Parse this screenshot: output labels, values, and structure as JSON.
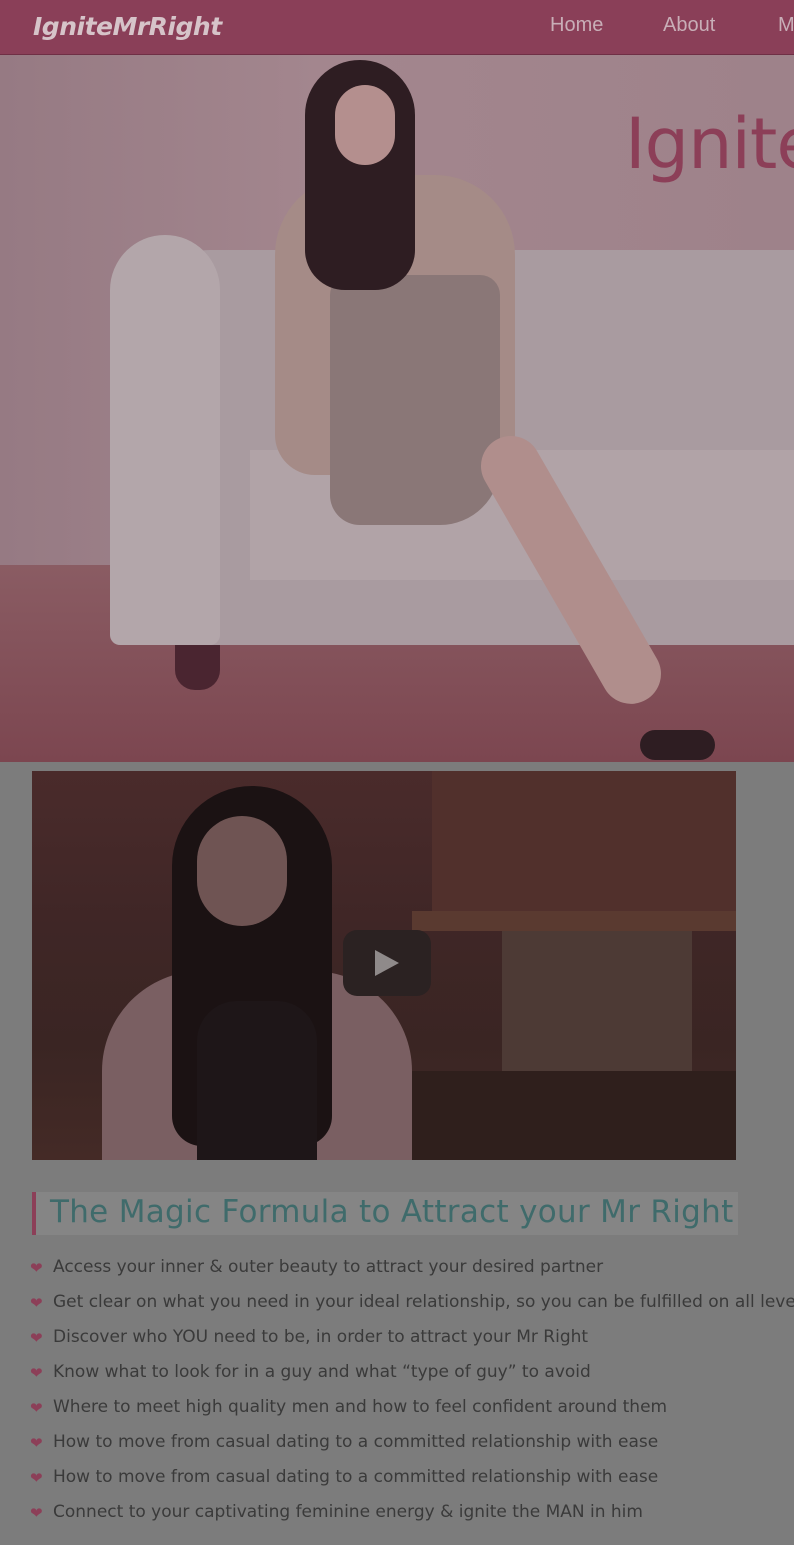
{
  "header": {
    "logo": "IgniteMrRight",
    "nav": [
      "Home",
      "About",
      "M"
    ]
  },
  "hero": {
    "heading": "Ignite"
  },
  "video": {
    "play_icon": "play-icon"
  },
  "section": {
    "title": "The Magic Formula to Attract your Mr Right",
    "bullet_icon": "heart-icon",
    "bullets": [
      "Access your inner & outer beauty to attract your desired partner",
      "Get clear on what you need in your ideal relationship, so you can be fulfilled on all levels",
      "Discover who YOU need to be, in order to attract your Mr Right",
      "Know what to look for in a guy and what “type of guy” to avoid",
      "Where to meet high quality men and how to feel confident around them",
      "How to move from casual dating to a committed relationship with ease",
      "How to move from casual dating to a committed relationship with ease",
      "Connect to your captivating feminine energy & ignite the MAN in him"
    ]
  },
  "colors": {
    "brand": "#8c3f58",
    "heading_teal": "#3f6b6b",
    "overlay_gray": "#7c7c7c"
  }
}
